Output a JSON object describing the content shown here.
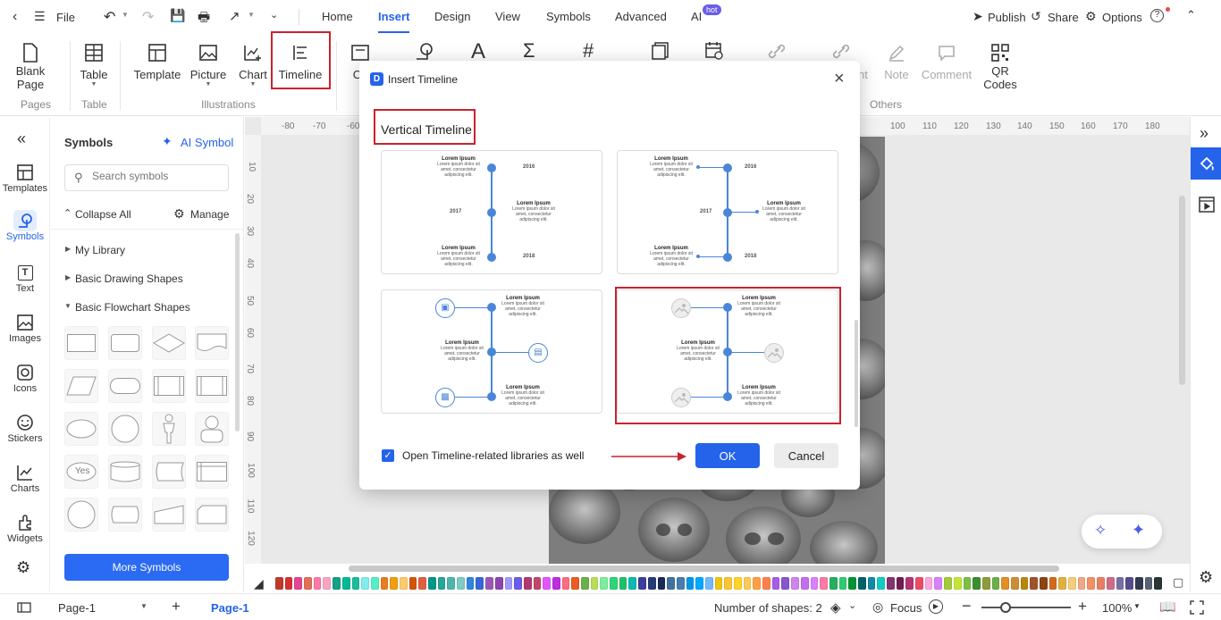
{
  "titlebar": {
    "file_label": "File",
    "tabs": [
      "Home",
      "Insert",
      "Design",
      "View",
      "Symbols",
      "Advanced",
      "AI"
    ],
    "ai_badge": "hot",
    "publish": "Publish",
    "share": "Share",
    "options": "Options"
  },
  "ribbon": {
    "blank_page": [
      "Blank",
      "Page"
    ],
    "table": "Table",
    "template": "Template",
    "picture": "Picture",
    "chart": "Chart",
    "timeline": "Timeline",
    "co_partial": "Co",
    "note": "Note",
    "comment": "Comment",
    "nt_partial": "nt",
    "qr_codes": [
      "QR",
      "Codes"
    ],
    "groups": {
      "pages": "Pages",
      "table": "Table",
      "illustrations": "Illustrations",
      "others": "Others"
    }
  },
  "leftnav": [
    {
      "label": "Templates",
      "icon": "templates-icon"
    },
    {
      "label": "Symbols",
      "icon": "symbols-icon"
    },
    {
      "label": "Text",
      "icon": "text-icon"
    },
    {
      "label": "Images",
      "icon": "images-icon"
    },
    {
      "label": "Icons",
      "icon": "icons-icon"
    },
    {
      "label": "Stickers",
      "icon": "stickers-icon"
    },
    {
      "label": "Charts",
      "icon": "charts-icon"
    },
    {
      "label": "Widgets",
      "icon": "widgets-icon"
    }
  ],
  "symbols": {
    "title": "Symbols",
    "ai_symbol": "AI Symbol",
    "search_placeholder": "Search symbols",
    "collapse_all": "Collapse All",
    "manage": "Manage",
    "libraries": [
      "My Library",
      "Basic Drawing Shapes",
      "Basic Flowchart Shapes"
    ],
    "yes_shape": "Yes",
    "more_symbols": "More Symbols"
  },
  "ruler": {
    "top": [
      "-80",
      "-70",
      "-60",
      "100",
      "110",
      "120",
      "130",
      "140",
      "150",
      "160",
      "170",
      "180"
    ],
    "left": [
      "10",
      "20",
      "30",
      "40",
      "50",
      "60",
      "70",
      "80",
      "90",
      "100",
      "110",
      "120"
    ]
  },
  "dialog": {
    "title": "Insert Timeline",
    "section": "Vertical Timeline",
    "lorem": "Lorem Ipsum",
    "lorem_body": "Lorem ipsum dolor sit amet, consectetur adipiscing elit.",
    "years": [
      "2016",
      "2017",
      "2018"
    ],
    "checkbox_label": "Open Timeline-related libraries as well",
    "checkbox_checked": true,
    "ok": "OK",
    "cancel": "Cancel"
  },
  "colors": [
    "#c0392b",
    "#d63031",
    "#e84393",
    "#e17055",
    "#fd79a8",
    "#f8a5c2",
    "#16a085",
    "#00b894",
    "#1abc9c",
    "#81ecec",
    "#55efc4",
    "#e67e22",
    "#f39c12",
    "#fdcb6e",
    "#d35400",
    "#e15f41",
    "#009688",
    "#26a69a",
    "#4db6ac",
    "#80cbc4",
    "#2e86de",
    "#3867d6",
    "#9b59b6",
    "#8e44ad",
    "#a29bfe",
    "#6c5ce7",
    "#b33771",
    "#c44569",
    "#e056fd",
    "#be2edd",
    "#ff6b81",
    "#ee5a24",
    "#6ab04c",
    "#badc58",
    "#7bed9f",
    "#2ed573",
    "#20bf6b",
    "#0fb9b1",
    "#3d3d9b",
    "#273c75",
    "#192a56",
    "#40739e",
    "#487eb0",
    "#0097e6",
    "#00a8ff",
    "#74b9ff",
    "#f1c40f",
    "#fbc531",
    "#ffd32a",
    "#feca57",
    "#ff9f43",
    "#ff7f50",
    "#a55eea",
    "#8854d0",
    "#cd84f1",
    "#c56cf0",
    "#d980fa",
    "#fd79a8",
    "#27ae60",
    "#2ecc71",
    "#009432",
    "#006266",
    "#1289a7",
    "#12cbc4",
    "#833471",
    "#6f1e51",
    "#b53471",
    "#ed4c67",
    "#fda7df",
    "#d980fa",
    "#a3cb38",
    "#c4e538",
    "#7bc043",
    "#3c8d2f",
    "#8e9b3b",
    "#6ab04c",
    "#e58e26",
    "#cc8e35",
    "#b8860b",
    "#a0522d",
    "#8b4513",
    "#d2691e",
    "#e2b13c",
    "#f5cd79",
    "#f3a683",
    "#f19066",
    "#e77f67",
    "#cf6a87",
    "#786fa6",
    "#574b90",
    "#303952",
    "#596275",
    "#2d3436",
    "#636e72",
    "#b2bec3",
    "#dfe6e9",
    "#000000",
    "#333333",
    "#555555",
    "#777777",
    "#999999",
    "#bbbbbb",
    "#dddddd",
    "#ffffff"
  ],
  "status": {
    "page_tab": "Page-1",
    "page_active": "Page-1",
    "shapes": "Number of shapes: 2",
    "focus": "Focus",
    "zoom": "100%"
  }
}
